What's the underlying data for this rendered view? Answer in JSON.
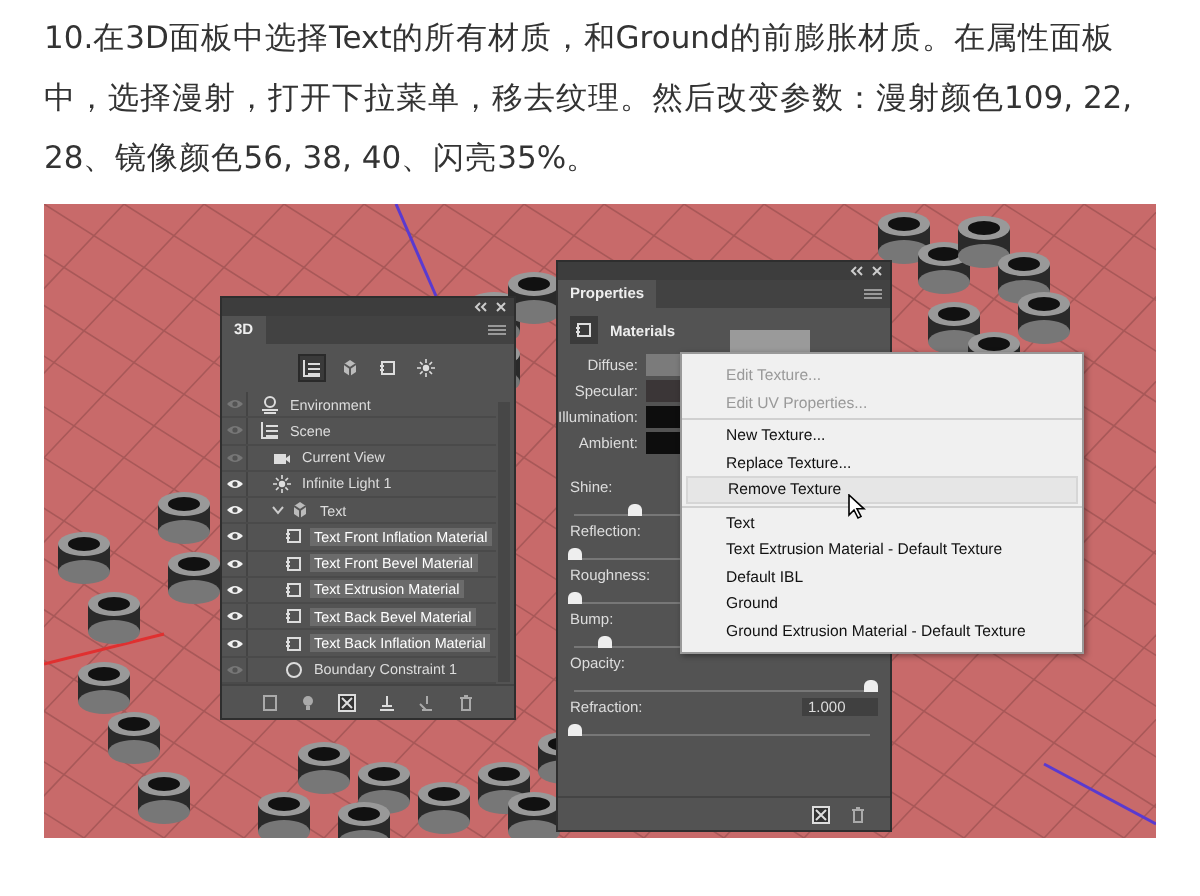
{
  "article": {
    "paragraph": "10.在3D面板中选择Text的所有材质，和Ground的前膨胀材质。在属性面板中，选择漫射，打开下拉菜单，移去纹理。然后改变参数：漫射颜色109, 22, 28、镜像颜色56, 38, 40、闪亮35%。"
  },
  "screenshot": {
    "panel_3d": {
      "title": "3D",
      "tools": [
        {
          "kind": "scene",
          "selected": true
        },
        {
          "kind": "mesh",
          "selected": false
        },
        {
          "kind": "material",
          "selected": false
        },
        {
          "kind": "light",
          "selected": false
        }
      ],
      "items": [
        {
          "label": "Environment",
          "kind": "environment",
          "visible": false,
          "selected": false
        },
        {
          "label": "Scene",
          "kind": "scene",
          "visible": false,
          "selected": false,
          "children": [
            {
              "label": "Current View",
              "kind": "camera",
              "visible": false,
              "selected": false
            },
            {
              "label": "Infinite Light 1",
              "kind": "light",
              "visible": true,
              "selected": false
            },
            {
              "label": "Text",
              "kind": "mesh",
              "visible": true,
              "selected": false,
              "expanded": true,
              "children": [
                {
                  "label": "Text Front Inflation Material",
                  "kind": "material",
                  "visible": true,
                  "selected": true
                },
                {
                  "label": "Text Front Bevel Material",
                  "kind": "material",
                  "visible": true,
                  "selected": true
                },
                {
                  "label": "Text Extrusion Material",
                  "kind": "material",
                  "visible": true,
                  "selected": true
                },
                {
                  "label": "Text Back Bevel Material",
                  "kind": "material",
                  "visible": true,
                  "selected": true
                },
                {
                  "label": "Text Back Inflation Material",
                  "kind": "material",
                  "visible": true,
                  "selected": true
                },
                {
                  "label": "Boundary Constraint 1",
                  "kind": "constraint",
                  "visible": false,
                  "selected": false
                }
              ]
            }
          ]
        }
      ]
    },
    "properties_panel": {
      "tab": "Properties",
      "header": "Materials",
      "colors": [
        {
          "label": "Diffuse:",
          "color": "#7b7b7b"
        },
        {
          "label": "Specular:",
          "color": "#3b3637"
        },
        {
          "label": "Illumination:",
          "color": "#0d0d0d"
        },
        {
          "label": "Ambient:",
          "color": "#0d0d0d"
        }
      ],
      "sliders": [
        {
          "label": "Shine:",
          "level": 0.2
        },
        {
          "label": "Reflection:",
          "level": 0
        },
        {
          "label": "Roughness:",
          "level": 0
        },
        {
          "label": "Bump:",
          "level": 0.1
        },
        {
          "label": "Opacity:",
          "level": 1
        },
        {
          "label": "Refraction:",
          "level": 0,
          "value": "1.000"
        }
      ]
    },
    "context_menu": {
      "groups": [
        [
          {
            "label": "Edit Texture...",
            "disabled": true,
            "selected": false
          },
          {
            "label": "Edit UV Properties...",
            "disabled": true,
            "selected": false
          }
        ],
        [
          {
            "label": "New Texture...",
            "disabled": false,
            "selected": false
          },
          {
            "label": "Replace Texture...",
            "disabled": false,
            "selected": false
          },
          {
            "label": "Remove Texture",
            "disabled": false,
            "selected": true
          }
        ],
        [
          {
            "label": "Text",
            "disabled": false,
            "selected": false
          },
          {
            "label": "Text Extrusion Material - Default Texture",
            "disabled": false,
            "selected": false
          },
          {
            "label": "Default IBL",
            "disabled": false,
            "selected": false
          },
          {
            "label": "Ground",
            "disabled": false,
            "selected": false
          },
          {
            "label": "Ground Extrusion Material - Default Texture",
            "disabled": false,
            "selected": false
          }
        ]
      ]
    }
  }
}
